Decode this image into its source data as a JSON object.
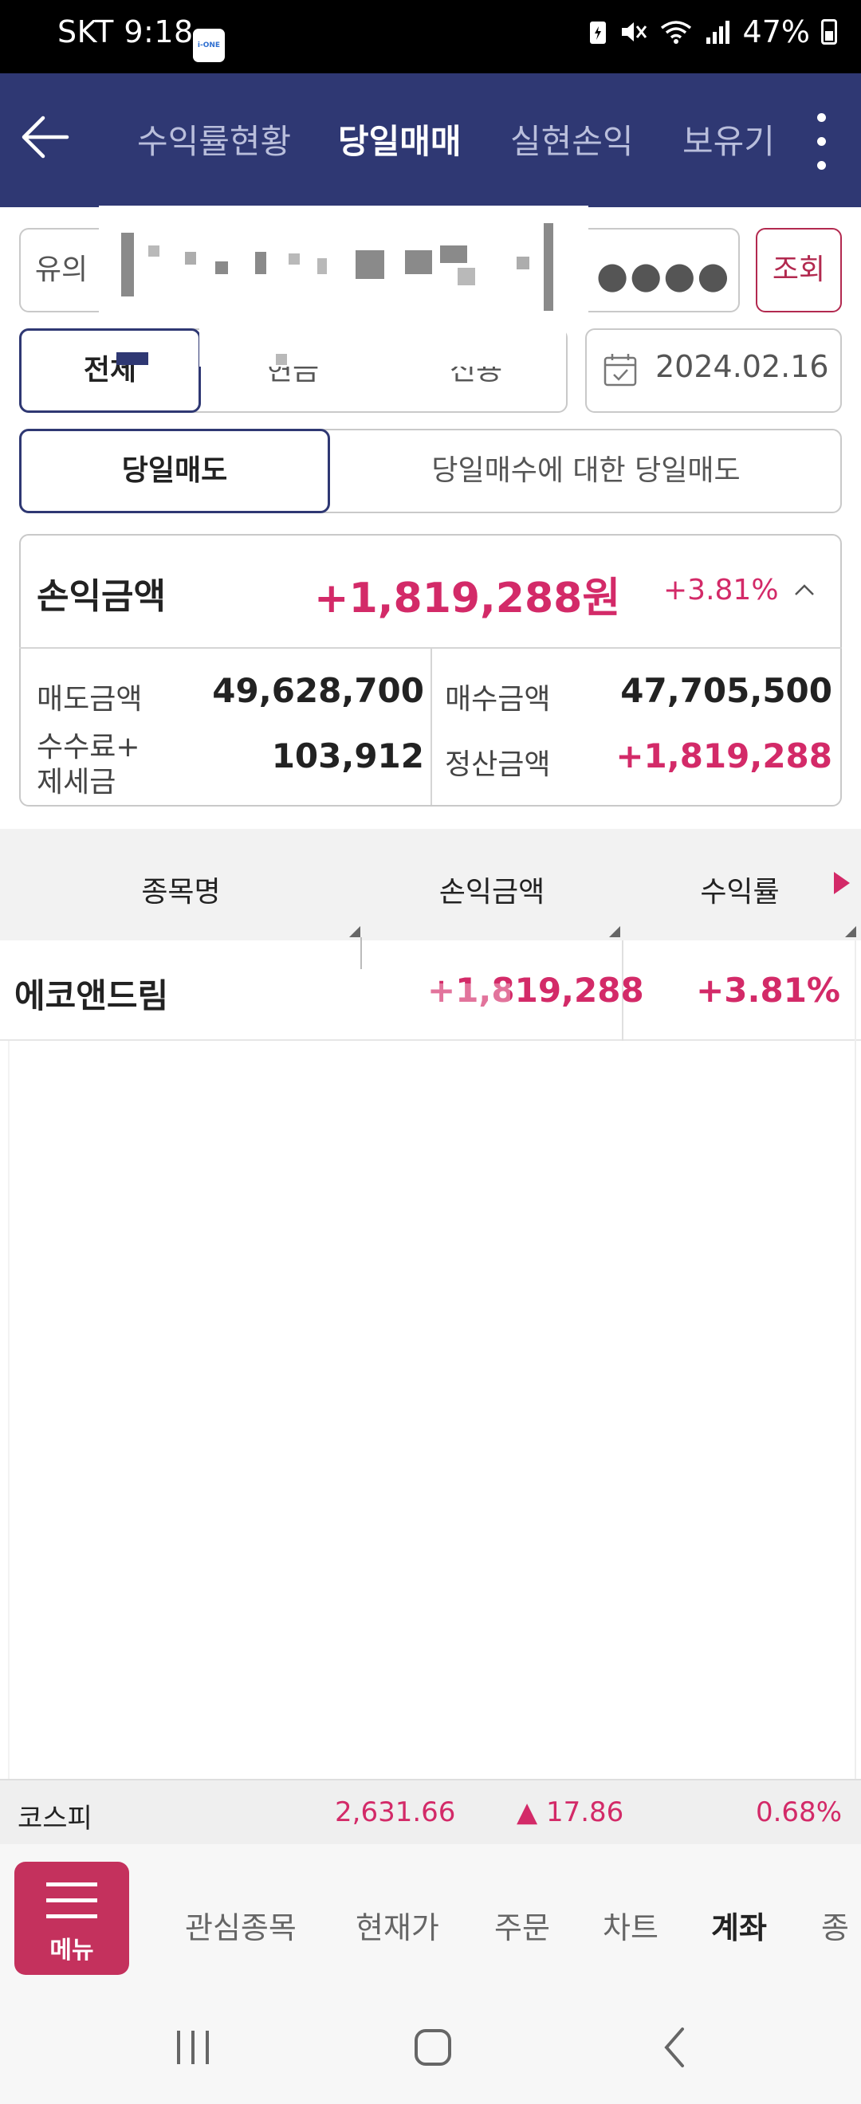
{
  "status_bar": {
    "carrier_time": "SKT 9:18",
    "app_badge": "i-ONE",
    "battery": "47%"
  },
  "header": {
    "tabs": [
      {
        "label": "수익률현황",
        "active": false
      },
      {
        "label": "당일매매",
        "active": true
      },
      {
        "label": "실현손익",
        "active": false
      },
      {
        "label": "보유기",
        "active": false
      }
    ]
  },
  "account": {
    "label": "유의",
    "password_mask": "●●●●",
    "query_label": "조회"
  },
  "filter": {
    "segments": [
      "전체",
      "현금",
      "신용"
    ],
    "selected": "전체",
    "date": "2024.02.16"
  },
  "sell_toggle": {
    "left": "당일매도",
    "right": "당일매수에 대한 당일매도",
    "selected": "당일매도"
  },
  "summary": {
    "pl_label": "손익금액",
    "pl_value": "+1,819,288원",
    "pl_pct": "+3.81%",
    "sell_amount_label": "매도금액",
    "sell_amount": "49,628,700",
    "buy_amount_label": "매수금액",
    "buy_amount": "47,705,500",
    "fee_tax_label_1": "수수료+",
    "fee_tax_label_2": "제세금",
    "fee_tax": "103,912",
    "settle_label": "정산금액",
    "settle_amount": "+1,819,288"
  },
  "table": {
    "columns": [
      "종목명",
      "손익금액",
      "수익률"
    ],
    "rows": [
      {
        "name": "에코앤드림",
        "pl": "+1,819,288",
        "rate": "+3.81%"
      }
    ]
  },
  "index_bar": {
    "name": "코스피",
    "value": "2,631.66",
    "change": "▲ 17.86",
    "pct": "0.68%"
  },
  "bottom_nav": {
    "menu_label": "메뉴",
    "items": [
      {
        "label": "관심종목",
        "active": false
      },
      {
        "label": "현재가",
        "active": false
      },
      {
        "label": "주문",
        "active": false
      },
      {
        "label": "차트",
        "active": false
      },
      {
        "label": "계좌",
        "active": true
      },
      {
        "label": "종",
        "active": false
      }
    ]
  },
  "colors": {
    "header_bg": "#2f3873",
    "accent_red": "#d32a68",
    "menu_btn": "#c4315d"
  }
}
